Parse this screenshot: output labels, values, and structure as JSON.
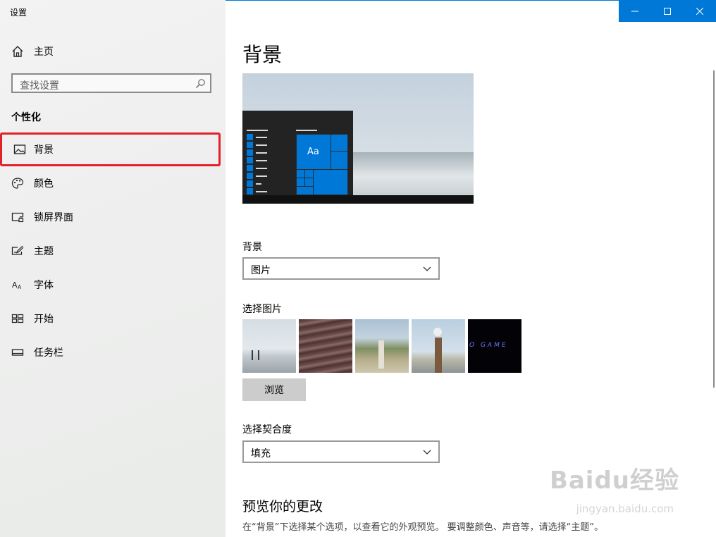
{
  "window": {
    "title": "设置",
    "accent": "#0078d7",
    "controls": [
      "minimize-icon",
      "maximize-icon",
      "close-icon"
    ]
  },
  "sidebar": {
    "home_label": "主页",
    "search_placeholder": "查找设置",
    "section_title": "个性化",
    "items": [
      {
        "label": "背景",
        "icon": "picture-icon",
        "selected": true
      },
      {
        "label": "颜色",
        "icon": "palette-icon"
      },
      {
        "label": "锁屏界面",
        "icon": "lock-screen-icon"
      },
      {
        "label": "主题",
        "icon": "theme-brush-icon"
      },
      {
        "label": "字体",
        "icon": "font-icon"
      },
      {
        "label": "开始",
        "icon": "start-grid-icon"
      },
      {
        "label": "任务栏",
        "icon": "taskbar-icon"
      }
    ],
    "highlight_color": "#e0232b"
  },
  "main": {
    "page_title": "背景",
    "preview_sample_text": "Aa",
    "background_label": "背景",
    "background_value": "图片",
    "choose_picture_label": "选择图片",
    "thumbnails": [
      {
        "name": "beach-people-thumbnail"
      },
      {
        "name": "water-ripples-thumbnail"
      },
      {
        "name": "dune-path-thumbnail"
      },
      {
        "name": "seagull-post-thumbnail"
      },
      {
        "name": "dark-game-thumbnail",
        "text": "O GAME"
      }
    ],
    "browse_label": "浏览",
    "fit_label": "选择契合度",
    "fit_value": "填充",
    "preview_changes_title": "预览你的更改",
    "preview_changes_desc": "在“背景”下选择某个选项，以查看它的外观预览。 要调整颜色、声音等，请选择“主题”。"
  },
  "watermark": {
    "text": "Baidu经验",
    "sub": "jingyan.baidu.com"
  }
}
